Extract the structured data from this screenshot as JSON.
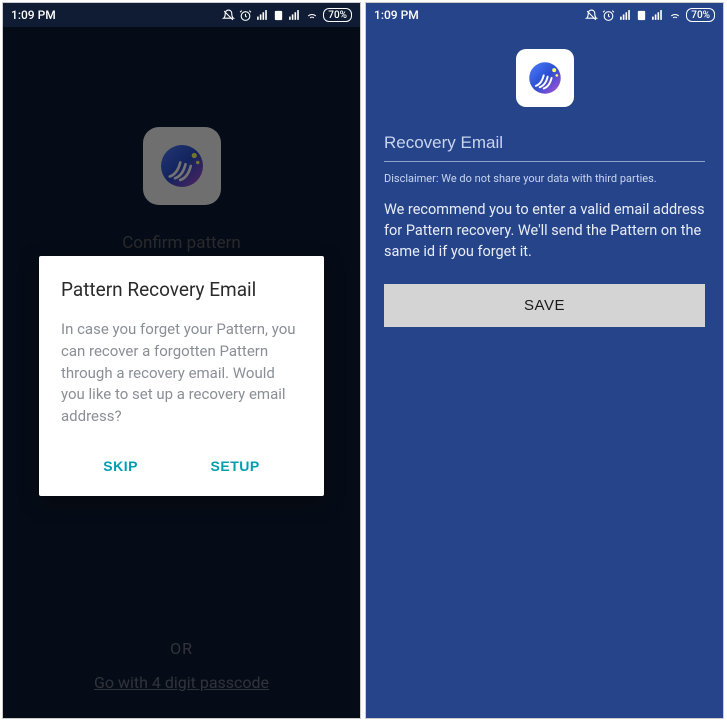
{
  "status": {
    "time": "1:09 PM",
    "battery": "70%"
  },
  "screen1": {
    "bg_title": "Confirm pattern",
    "or_label": "OR",
    "passcode_link": "Go with 4 digit passcode",
    "dialog": {
      "title": "Pattern Recovery Email",
      "body": "In case you forget your Pattern, you can recover a forgotten Pattern through a recovery email. Would you like to set up a recovery email address?",
      "skip": "SKIP",
      "setup": "SETUP"
    }
  },
  "screen2": {
    "email_placeholder": "Recovery Email",
    "disclaimer": "Disclaimer: We do not share your data with third parties.",
    "recommend": "We recommend you to enter a valid email address for Pattern recovery. We'll send the Pattern on the same id if you forget it.",
    "save": "SAVE"
  }
}
